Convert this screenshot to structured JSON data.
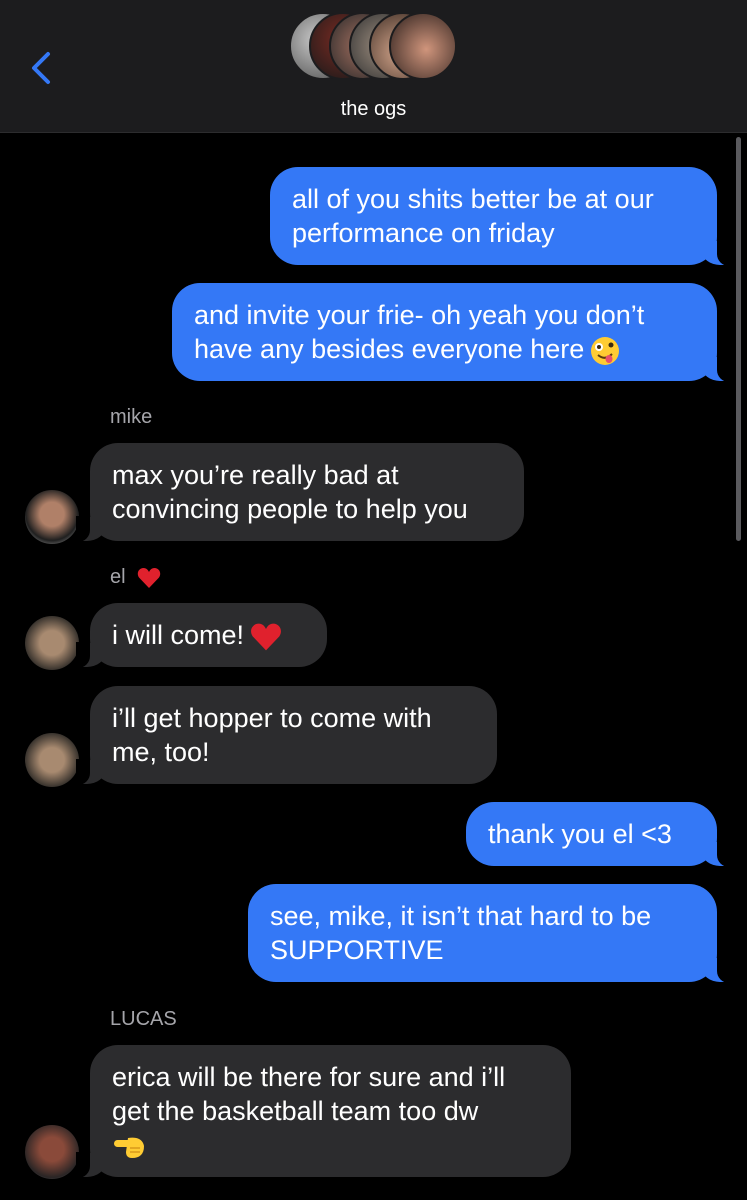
{
  "header": {
    "back_icon": "chevron-left-icon",
    "group_name": "the ogs",
    "accent_color": "#3478f6"
  },
  "messages": [
    {
      "direction": "outgoing",
      "text": "all of you shits better be at our performance on friday"
    },
    {
      "direction": "outgoing",
      "text": "and invite your frie- oh yeah you don’t have any besides everyone here",
      "emoji": "zany-face-icon"
    },
    {
      "direction": "incoming",
      "sender": "mike",
      "text": "max you’re really bad at convincing people to help you"
    },
    {
      "direction": "incoming",
      "sender": "el",
      "sender_emoji": "red-heart-icon",
      "text": "i will come!",
      "emoji": "red-heart-icon"
    },
    {
      "direction": "incoming",
      "sender": "el",
      "text": "i’ll get hopper to come with me, too!"
    },
    {
      "direction": "outgoing",
      "text": "thank you el <3"
    },
    {
      "direction": "outgoing",
      "text": "see, mike, it isn’t that hard to be SUPPORTIVE"
    },
    {
      "direction": "incoming",
      "sender": "LUCAS",
      "text": "erica will be there for sure and i’ll get the basketball team too dw",
      "emoji": "backhand-index-pointing-left-icon"
    }
  ]
}
